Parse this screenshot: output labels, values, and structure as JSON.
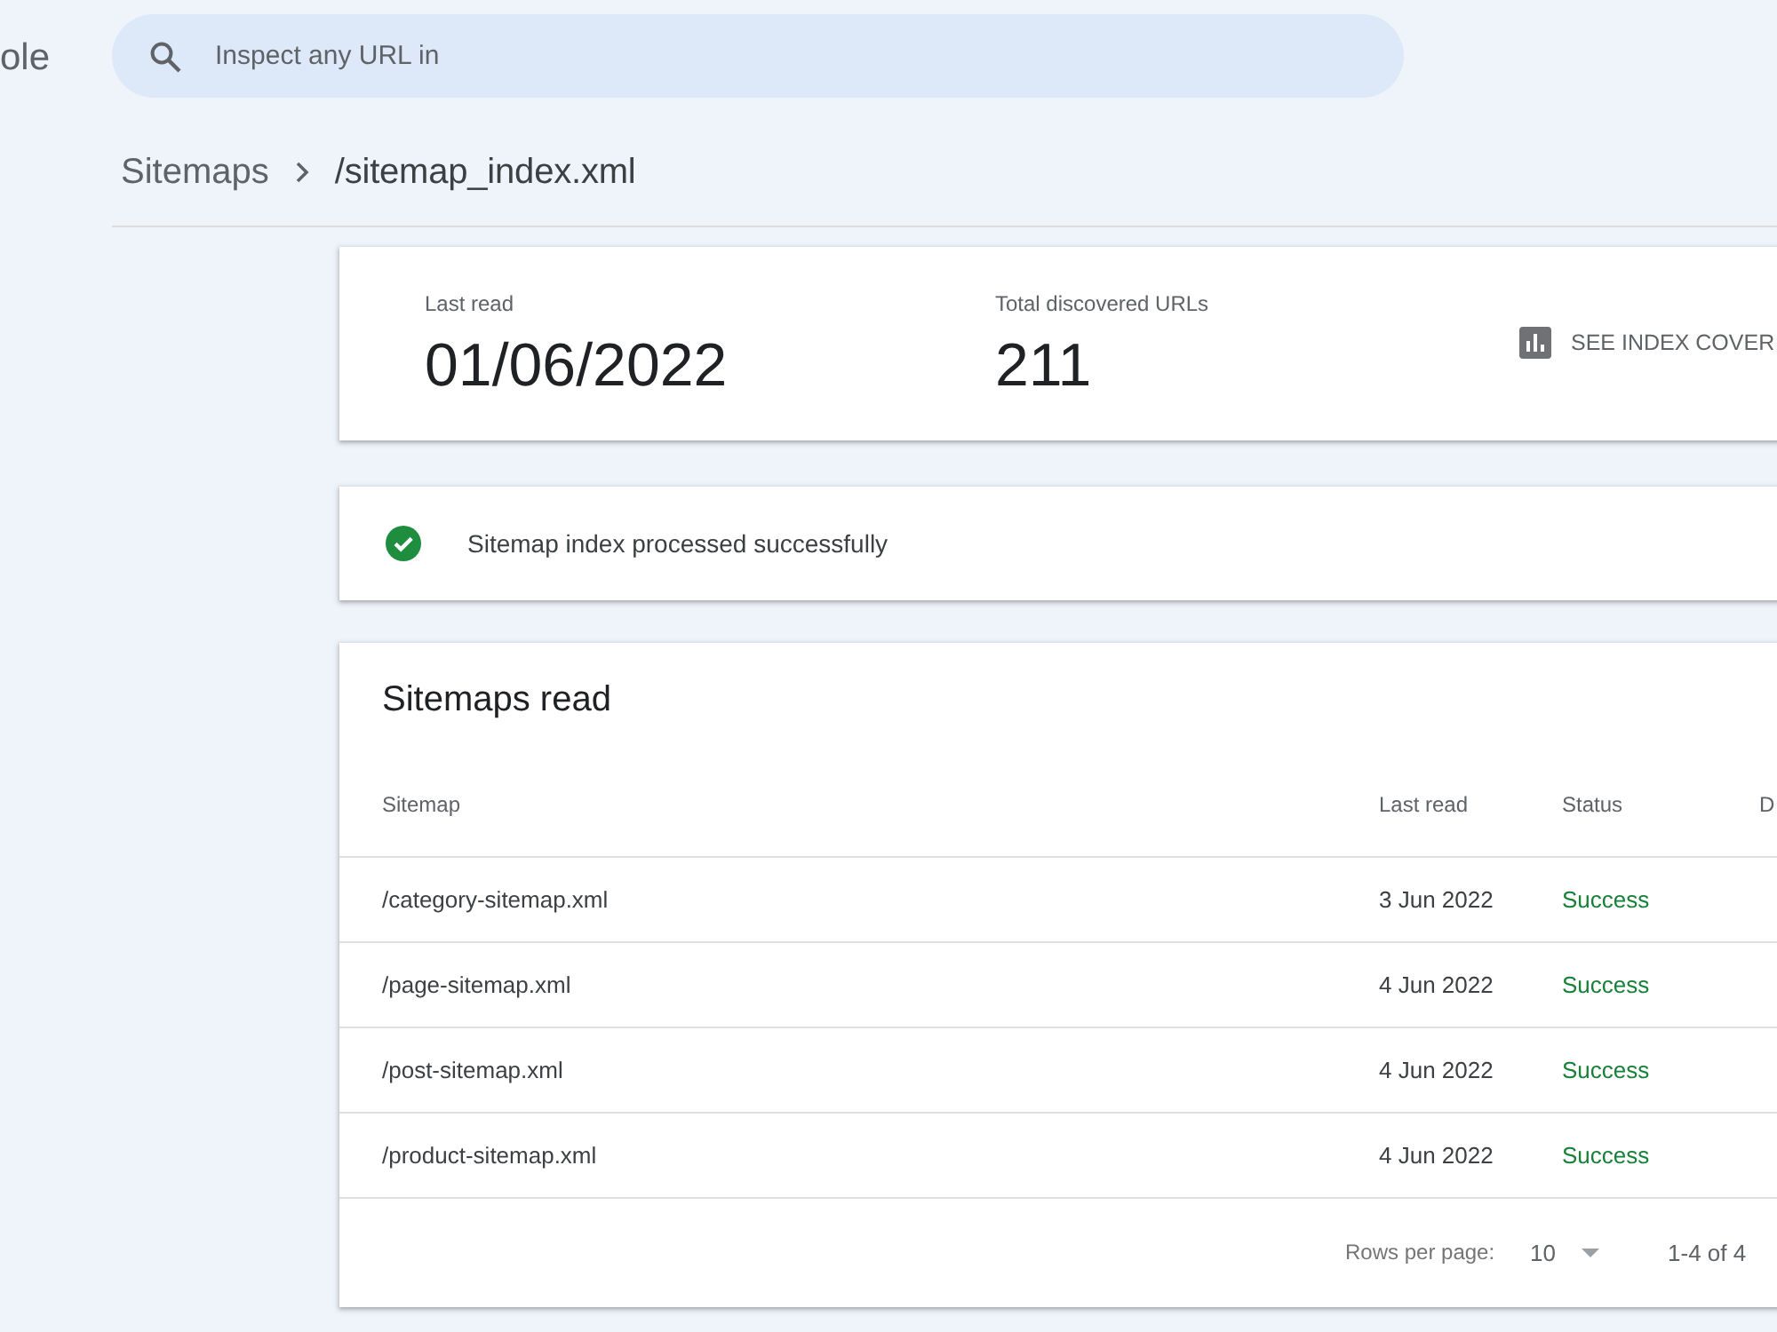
{
  "app_logo": {
    "text": "ole"
  },
  "search": {
    "placeholder": "Inspect any URL in"
  },
  "breadcrumb": [
    {
      "label": "Sitemaps",
      "current": false
    },
    {
      "label": "/sitemap_index.xml",
      "current": true
    }
  ],
  "summary": {
    "stats": [
      {
        "label": "Last read",
        "value": "01/06/2022"
      },
      {
        "label": "Total discovered URLs",
        "value": "211"
      }
    ],
    "action": "SEE INDEX COVER"
  },
  "status_message": {
    "kind": "success",
    "text": "Sitemap index processed successfully"
  },
  "sitemaps_table": {
    "title": "Sitemaps read",
    "columns": [
      "Sitemap",
      "Last read",
      "Status",
      "D"
    ],
    "rows": [
      {
        "sitemap": "/category-sitemap.xml",
        "last_read": "3 Jun 2022",
        "status": "Success"
      },
      {
        "sitemap": "/page-sitemap.xml",
        "last_read": "4 Jun 2022",
        "status": "Success"
      },
      {
        "sitemap": "/post-sitemap.xml",
        "last_read": "4 Jun 2022",
        "status": "Success"
      },
      {
        "sitemap": "/product-sitemap.xml",
        "last_read": "4 Jun 2022",
        "status": "Success"
      }
    ],
    "pagination": {
      "rows_per_page_label": "Rows per page:",
      "rows_per_page": "10",
      "range": "1-4 of 4"
    }
  }
}
